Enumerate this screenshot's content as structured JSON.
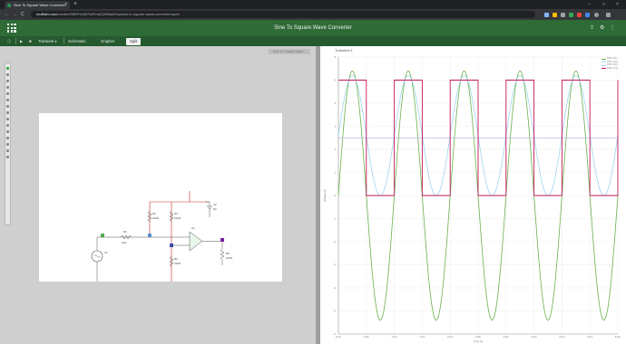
{
  "browser": {
    "tab_title": "Sine To Square Wave Converter",
    "tab_close": "×",
    "new_tab": "+",
    "address_domain": "multisim.com",
    "address_path": "/content/MRPeQWTwRHaZQNBabEnq/sine-to-square-wave-converter/open",
    "back": "←",
    "forward": "→",
    "reload": "C",
    "minimize": "–",
    "maximize": "□",
    "close": "×"
  },
  "app": {
    "title": "Sine To Square Wave Converter",
    "settings_glyph": "⚙",
    "share_glyph": "⇪",
    "menu_glyph": "⋮"
  },
  "toolbar": {
    "info": "ⓘ",
    "play": "▶",
    "stop": "■",
    "analysis": "Transient",
    "analysis_caret": "▾",
    "schematic": "Schematic",
    "grapher": "Grapher",
    "split": "Split"
  },
  "schematic": {
    "panel_label": "Sine To Square Wave...",
    "components": {
      "v1": "V1",
      "v1_val": "2 Vpk\n1kHz",
      "r1": "R1",
      "r1_val": "1kΩ",
      "r2": "R2",
      "r2_val": "10kΩ",
      "r3": "R3",
      "r3_val": "10kΩ",
      "r4": "R4",
      "r4_val": "10kΩ",
      "v2": "V2",
      "v2_val": "5V",
      "u1": "U1",
      "rl": "R5",
      "rl_val": "10kΩ"
    }
  },
  "grapher": {
    "title": "Transient 1",
    "legend": [
      {
        "name": "PR1 V(1)",
        "color": "#6ab04c"
      },
      {
        "name": "PR2 V(2)",
        "color": "#9fd4ee"
      },
      {
        "name": "PR3 V(3)",
        "color": "#c2c4e8"
      },
      {
        "name": "PR4 V(4)",
        "color": "#c2185b"
      }
    ],
    "xlabel": "Time (s)",
    "ylabel": "Voltage (V)"
  },
  "chart_data": {
    "type": "line",
    "title": "Transient 1",
    "xlabel": "Time (s)",
    "ylabel": "Voltage (V)",
    "xlim": [
      0,
      0.005
    ],
    "ylim": [
      -6,
      6
    ],
    "grid": true,
    "legend_position": "top-right",
    "period_s": 0.001,
    "series": [
      {
        "name": "PR1 V(1)",
        "shape": "sine",
        "amplitude": 5.4,
        "offset": 0,
        "color": "#6ab04c"
      },
      {
        "name": "PR2 V(2)",
        "shape": "sine",
        "amplitude": 2.6,
        "offset": 2.6,
        "color": "#9fd4ee"
      },
      {
        "name": "PR3 V(3)",
        "shape": "constant",
        "value": 2.5,
        "color": "#b6b9e6"
      },
      {
        "name": "PR4 V(4)",
        "shape": "square",
        "high": 5.0,
        "low": 0.0,
        "duty": 0.5,
        "color": "#c2185b"
      }
    ]
  }
}
